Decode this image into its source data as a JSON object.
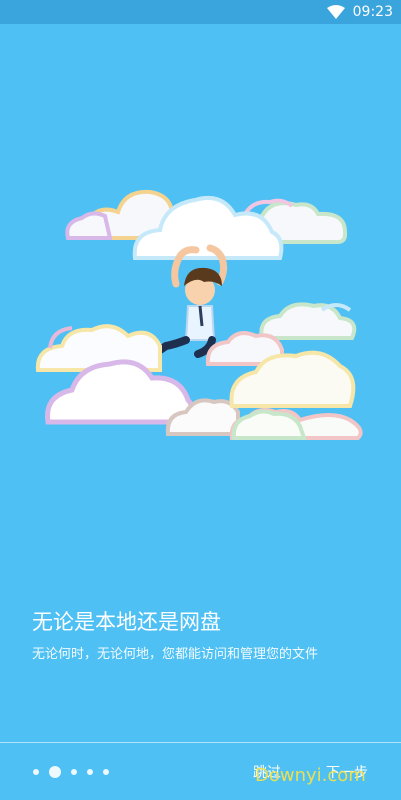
{
  "status_bar": {
    "time": "09:23",
    "wifi_icon": "wifi-icon"
  },
  "illustration": {
    "description_icon": "man-jumping-on-clouds"
  },
  "onboarding": {
    "headline": "无论是本地还是网盘",
    "subtitle": "无论何时，无论何地，您都能访问和管理您的文件",
    "page_indicator": {
      "total": 5,
      "active_index": 1
    },
    "skip_label": "跳过",
    "next_label": "下一步"
  },
  "watermark": {
    "text": "Downyi.com"
  },
  "colors": {
    "background": "#4fc0f4",
    "status_bar": "#3aa5dd",
    "watermark": "#f2e14a"
  }
}
